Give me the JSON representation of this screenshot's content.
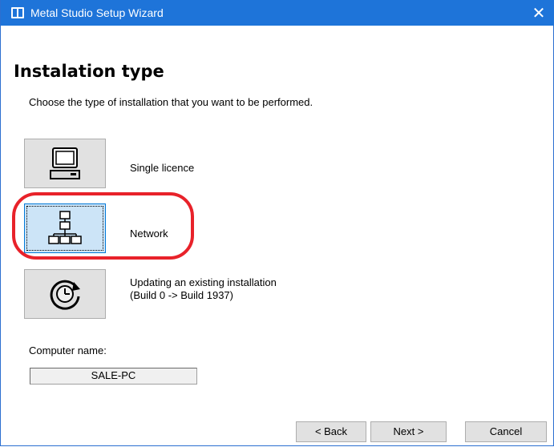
{
  "window": {
    "title": "Metal Studio Setup Wizard",
    "close_glyph": "✕"
  },
  "page": {
    "heading": "Instalation type",
    "subtitle": "Choose the type of installation that you want to be performed."
  },
  "options": [
    {
      "icon": "computer-icon",
      "label": "Single licence",
      "selected": false
    },
    {
      "icon": "network-icon",
      "label": "Network",
      "selected": true
    },
    {
      "icon": "update-icon",
      "label_line1": "Updating an existing installation",
      "label_line2": "(Build 0 -> Build 1937)",
      "selected": false
    }
  ],
  "computer": {
    "label": "Computer name:",
    "value": "SALE-PC"
  },
  "buttons": {
    "back": "< Back",
    "next": "Next >",
    "cancel": "Cancel"
  },
  "colors": {
    "titlebar": "#1e74d9",
    "highlight": "#e8222a",
    "selected_button": "#cce4f7"
  }
}
